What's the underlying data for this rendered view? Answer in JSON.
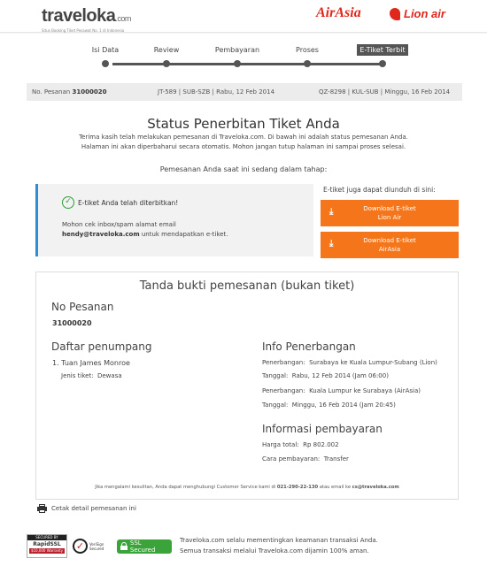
{
  "header": {
    "logo_name": "traveloka",
    "logo_tld": ".com",
    "logo_tagline": "Situs Booking Tiket Pesawat No. 1 di Indonesia",
    "airline1": "AirAsia",
    "airline2": "Lion air"
  },
  "steps": [
    {
      "label": "Isi Data",
      "active": false
    },
    {
      "label": "Review",
      "active": false
    },
    {
      "label": "Pembayaran",
      "active": false
    },
    {
      "label": "Proses",
      "active": false
    },
    {
      "label": "E-Tiket Terbit",
      "active": true
    }
  ],
  "order_bar": {
    "booking_label": "No. Pesanan",
    "booking_no": "31000020",
    "flight1": "JT-589 | SUB-SZB | Rabu, 12 Feb 2014",
    "flight2": "QZ-8298 | KUL-SUB | Minggu, 16 Feb 2014"
  },
  "page_title": "Status Penerbitan Tiket Anda",
  "intro": "Terima kasih telah melakukan pemesanan di Traveloka.com. Di bawah ini adalah status pemesanan Anda. Halaman ini akan diperbaharui secara otomatis. Mohon jangan tutup halaman ini sampai proses selesai.",
  "progress_heading": "Pemesanan Anda saat ini sedang dalam tahap:",
  "status": {
    "title": "E-tiket Anda telah diterbitkan!",
    "msg_line1": "Mohon cek inbox/spam alamat email",
    "email": "hendy@traveloka.com",
    "msg_line2_rest": " untuk mendapatkan e-tiket."
  },
  "download": {
    "label": "E-tiket juga dapat diunduh di sini:",
    "btn1_line1": "Download E-tiket",
    "btn1_line2": "Lion Air",
    "btn2_line1": "Download E-tiket",
    "btn2_line2": "AirAsia"
  },
  "receipt": {
    "title": "Tanda bukti pemesanan (bukan tiket)",
    "booking_heading": "No Pesanan",
    "booking_no": "31000020",
    "passenger_heading": "Daftar penumpang",
    "passenger": "1. Tuan James Monroe",
    "ticket_type_label": "Jenis tiket:",
    "ticket_type": "Dewasa",
    "flight_heading": "Info Penerbangan",
    "flights": [
      {
        "route_label": "Penerbangan:",
        "route": "Surabaya ke Kuala Lumpur-Subang (Lion)",
        "date_label": "Tanggal:",
        "date": "Rabu, 12 Feb 2014 (Jam 06:00)"
      },
      {
        "route_label": "Penerbangan:",
        "route": "Kuala Lumpur ke Surabaya (AirAsia)",
        "date_label": "Tanggal:",
        "date": "Minggu, 16 Feb 2014 (Jam 20:45)"
      }
    ],
    "payment_heading": "Informasi pembayaran",
    "price_label": "Harga total:",
    "price": "Rp 802.002",
    "method_label": "Cara pembayaran:",
    "method": "Transfer",
    "footer_prefix": "Jika mengalami kesulitan, Anda dapat menghubungi Customer Service kami di ",
    "cs_phone": "021-290-22-130",
    "footer_mid": " atau email ke ",
    "cs_email": "cs@traveloka.com"
  },
  "print_label": "Cetak detail pemesanan ini",
  "security": {
    "rapidssl_top": "SECURED BY",
    "rapidssl_main": "RapidSSL",
    "rapidssl_warranty": "$10,000 Warranty",
    "verisign_line1": "VeriSign",
    "verisign_line2": "Secured",
    "ssl_secured": "SSL Secured",
    "text_line1": "Traveloka.com selalu mementingkan keamanan transaksi Anda.",
    "text_line2": "Semua transaksi melalui Traveloka.com dijamin 100% aman."
  }
}
